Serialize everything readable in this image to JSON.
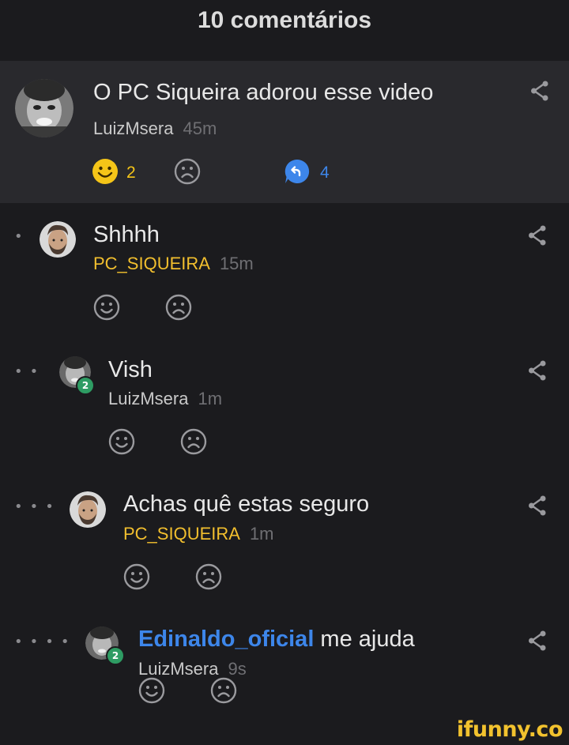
{
  "header": {
    "title": "10 comentários"
  },
  "top_comment": {
    "text": "O PC Siqueira adorou esse video",
    "user": "LuizMsera",
    "time": "45m",
    "likes": "2",
    "replies": "4"
  },
  "replies": [
    {
      "text": "Shhhh",
      "user": "PC_SIQUEIRA",
      "time": "15m",
      "dots": "•"
    },
    {
      "text": "Vish",
      "user": "LuizMsera",
      "time": "1m",
      "badge": "2",
      "dots": "••"
    },
    {
      "text": "Achas quê estas seguro",
      "user": "PC_SIQUEIRA",
      "time": "1m",
      "dots": "•••"
    },
    {
      "mention": "Edinaldo_oficial",
      "text": " me ajuda",
      "user": "LuizMsera",
      "time": "9s",
      "badge": "2",
      "dots": "••••"
    }
  ],
  "watermark": "ifunny.co",
  "colors": {
    "background": "#1b1b1e",
    "highlight": "#29292d",
    "username_yellow": "#f2bf2e",
    "mention_blue": "#3d86ea",
    "like_yellow": "#f5c518",
    "badge_green": "#2e9c63"
  }
}
